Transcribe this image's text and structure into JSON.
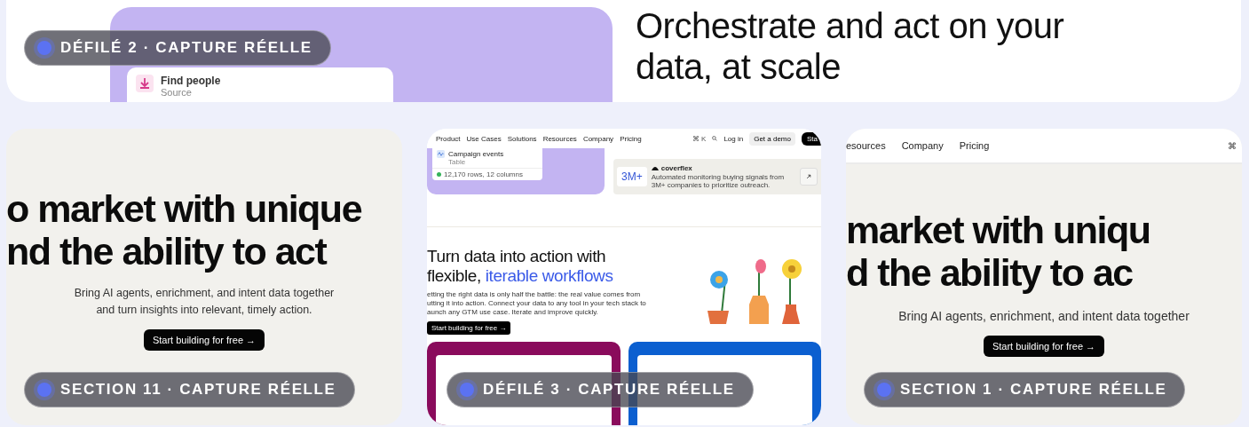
{
  "top_card": {
    "panel": {
      "title": "Find people",
      "subtitle": "Source"
    },
    "heading": "Orchestrate and act on your data, at scale",
    "badge": "DÉFILÉ 2 · CAPTURE RÉELLE"
  },
  "cards": [
    {
      "kind": "hero",
      "heading_lines": [
        "o market with unique",
        "nd the ability to act"
      ],
      "body_lines": [
        "Bring AI agents, enrichment, and intent data together",
        "and turn insights into relevant, timely action."
      ],
      "button": "Start building for free →",
      "badge": "SECTION 11 · CAPTURE RÉELLE"
    },
    {
      "kind": "page",
      "nav": [
        "Product",
        "Use Cases",
        "Solutions",
        "Resources",
        "Company",
        "Pricing"
      ],
      "nav_keys": "⌘ K",
      "login": "Log in",
      "demo": "Get a demo",
      "start": "Sta",
      "table_card": {
        "title": "Campaign events",
        "subtitle": "Table",
        "meta": "12,170 rows, 12 columns"
      },
      "stat": {
        "value": "3M+",
        "brand": "coverflex",
        "description": "Automated monitoring buying signals from 3M+ companies to prioritize outreach."
      },
      "heading": "Turn data into action with flexible, ",
      "heading_highlight": "iterable workflows",
      "body_lines": [
        "etting the right data is only half the battle: the real value comes from",
        "utting it into action. Connect your data to any tool in your tech stack to",
        "aunch any GTM use case. Iterate and improve quickly."
      ],
      "button": "Start building for free →",
      "badge": "DÉFILÉ 3 · CAPTURE RÉELLE"
    },
    {
      "kind": "hero",
      "nav": [
        "esources",
        "Company",
        "Pricing"
      ],
      "nav_icon": "⌘",
      "heading_lines": [
        "market with uniqu",
        "d the ability to ac"
      ],
      "body_lines": [
        "Bring AI agents, enrichment, and intent data together"
      ],
      "button": "Start building for free →",
      "badge": "SECTION 1 · CAPTURE RÉELLE"
    }
  ]
}
